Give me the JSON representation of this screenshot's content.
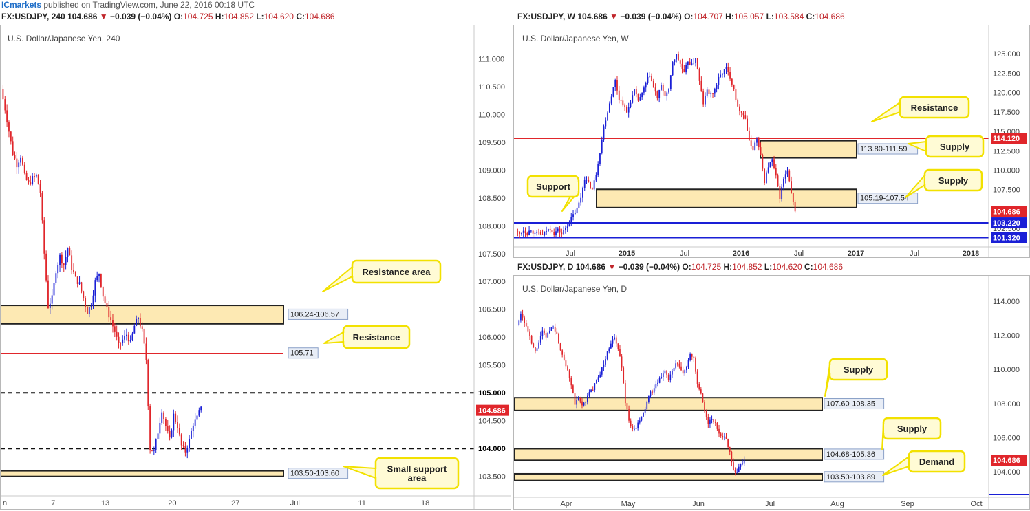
{
  "header": {
    "brand": "ICmarkets",
    "published": " published on TradingView.com, June 22, 2016 00:18 UTC"
  },
  "colors": {
    "up": "#1a1fd6",
    "down": "#e0262b",
    "zone_fill": "#fde9b3",
    "resistance_line": "#e0262b",
    "support_line": "#1a1fd6",
    "callout_fill": "#fffbd5",
    "callout_border": "#f2e100",
    "price_badge": "#e0262b"
  },
  "panels": {
    "h4": {
      "symbol": "FX:USDJPY, 240",
      "last": "104.686",
      "arrow": "▼",
      "change": "−0.039 (−0.04%)",
      "o": "104.725",
      "h": "104.852",
      "l": "104.620",
      "c": "104.686",
      "title": "U.S. Dollar/Japanese Yen, 240"
    },
    "weekly": {
      "symbol": "FX:USDJPY, W",
      "last": "104.686",
      "arrow": "▼",
      "change": "−0.039 (−0.04%)",
      "o": "104.707",
      "h": "105.057",
      "l": "103.584",
      "c": "104.686",
      "title": "U.S. Dollar/Japanese Yen, W"
    },
    "daily": {
      "symbol": "FX:USDJPY, D",
      "last": "104.686",
      "arrow": "▼",
      "change": "−0.039 (−0.04%)",
      "o": "104.725",
      "h": "104.852",
      "l": "104.620",
      "c": "104.686",
      "title": "U.S. Dollar/Japanese Yen, D"
    }
  },
  "chart_data": [
    {
      "id": "h4",
      "type": "candlestick",
      "ylim": [
        103.2,
        111.3
      ],
      "y_ticks": [
        "111.000",
        "110.500",
        "110.000",
        "109.500",
        "109.000",
        "108.500",
        "108.000",
        "107.500",
        "107.000",
        "106.500",
        "106.000",
        "105.500",
        "105.000",
        "104.500",
        "104.000",
        "103.500"
      ],
      "y_tick_values": [
        111.0,
        110.5,
        110.0,
        109.5,
        109.0,
        108.5,
        108.0,
        107.5,
        107.0,
        106.5,
        106.0,
        105.5,
        105.0,
        104.5,
        104.0,
        103.5
      ],
      "bold_ticks": [
        "105.000",
        "104.000"
      ],
      "x_ticks": [
        "n",
        "7",
        "13",
        "20",
        "27",
        "Jul",
        "11",
        "18"
      ],
      "x_tick_index": [
        0,
        13,
        27,
        45,
        62,
        78,
        96,
        113
      ],
      "x_count": 126,
      "current_price": 104.686,
      "price_series": [
        110.45,
        110.1,
        109.7,
        109.3,
        109.1,
        109.25,
        108.9,
        108.75,
        108.85,
        108.9,
        108.6,
        107.5,
        106.55,
        106.7,
        107.2,
        107.45,
        107.3,
        107.6,
        107.25,
        107.05,
        106.95,
        106.7,
        106.45,
        106.6,
        107.0,
        107.15,
        106.75,
        106.5,
        106.3,
        106.1,
        105.85,
        105.95,
        106.05,
        105.9,
        106.2,
        106.35,
        106.1,
        105.6,
        104.0,
        103.95,
        104.3,
        104.7,
        104.4,
        104.15,
        104.6,
        104.4,
        104.05,
        103.95,
        104.15,
        104.45,
        104.55,
        104.75
      ],
      "zones": [
        {
          "label": "106.24-106.57",
          "low": 106.24,
          "high": 106.57,
          "callout": "Resistance area"
        },
        {
          "label": "103.50-103.60",
          "low": 103.5,
          "high": 103.6,
          "callout": "Small support area"
        }
      ],
      "lines": [
        {
          "label": "105.71",
          "value": 105.71,
          "style": "solid",
          "callout": "Resistance"
        },
        {
          "value": 105.0,
          "style": "dashed"
        },
        {
          "value": 104.0,
          "style": "dashed"
        }
      ]
    },
    {
      "id": "weekly",
      "type": "candlestick",
      "ylim": [
        100.3,
        126.7
      ],
      "y_ticks": [
        "125.000",
        "122.500",
        "120.000",
        "117.500",
        "115.000",
        "112.500",
        "110.000",
        "107.500",
        "105.000",
        "102.500"
      ],
      "y_tick_values": [
        125.0,
        122.5,
        120.0,
        117.5,
        115.0,
        112.5,
        110.0,
        107.5,
        105.0,
        102.5
      ],
      "x_ticks": [
        "Jul",
        "2015",
        "Jul",
        "2016",
        "Jul",
        "2017",
        "Jul",
        "2018"
      ],
      "current_price": 104.686,
      "price_series": [
        102.1,
        101.8,
        102.3,
        101.9,
        102.4,
        101.7,
        102.0,
        101.6,
        102.2,
        102.5,
        101.9,
        102.3,
        101.8,
        102.6,
        103.3,
        104.2,
        105.0,
        106.5,
        109.0,
        108.3,
        107.5,
        109.6,
        112.4,
        115.6,
        117.6,
        119.7,
        121.5,
        119.2,
        118.6,
        117.4,
        118.9,
        120.2,
        119.0,
        119.8,
        121.2,
        122.3,
        120.6,
        119.4,
        120.8,
        119.7,
        120.2,
        124.0,
        124.8,
        123.7,
        122.4,
        124.1,
        123.5,
        124.5,
        121.4,
        118.6,
        120.3,
        119.7,
        120.4,
        121.8,
        122.6,
        123.1,
        122.0,
        120.5,
        118.0,
        117.6,
        116.7,
        113.6,
        112.8,
        114.1,
        111.7,
        108.6,
        110.5,
        111.3,
        109.1,
        106.5,
        108.9,
        109.9,
        106.9,
        104.7
      ],
      "zones": [
        {
          "label": "113.80-111.59",
          "low": 111.59,
          "high": 113.8,
          "callout": "Supply"
        },
        {
          "label": "105.19-107.54",
          "low": 105.19,
          "high": 107.54,
          "callout": "Supply"
        }
      ],
      "lines": [
        {
          "label": "114.120",
          "value": 114.12,
          "color": "red"
        },
        {
          "label": "103.220",
          "value": 103.22,
          "color": "blue"
        },
        {
          "label": "101.320",
          "value": 101.32,
          "color": "blue"
        }
      ],
      "callouts": [
        "Resistance",
        "Supply",
        "Supply",
        "Support"
      ]
    },
    {
      "id": "daily",
      "type": "candlestick",
      "ylim": [
        102.6,
        114.6
      ],
      "y_ticks": [
        "114.000",
        "112.000",
        "110.000",
        "108.000",
        "106.000",
        "104.000"
      ],
      "y_tick_values": [
        114.0,
        112.0,
        110.0,
        108.0,
        106.0,
        104.0
      ],
      "x_ticks": [
        "Apr",
        "May",
        "Jun",
        "Jul",
        "Aug",
        "Sep",
        "Oct"
      ],
      "current_price": 104.686,
      "price_series": [
        112.6,
        113.3,
        112.8,
        112.2,
        111.5,
        111.0,
        111.6,
        112.2,
        111.9,
        112.3,
        112.6,
        112.0,
        111.2,
        110.6,
        110.0,
        109.0,
        108.0,
        108.3,
        107.9,
        108.2,
        108.6,
        108.9,
        109.3,
        109.8,
        110.3,
        111.0,
        111.6,
        111.8,
        111.2,
        110.2,
        108.1,
        107.1,
        106.4,
        106.6,
        107.0,
        107.4,
        108.1,
        108.6,
        108.9,
        109.2,
        109.6,
        110.0,
        109.4,
        109.9,
        110.3,
        110.2,
        109.7,
        110.2,
        111.0,
        110.6,
        109.1,
        108.5,
        107.5,
        106.9,
        107.1,
        106.8,
        106.3,
        106.1,
        105.9,
        105.2,
        104.1,
        104.0,
        104.5,
        104.7
      ],
      "zones": [
        {
          "label": "107.60-108.35",
          "low": 107.6,
          "high": 108.35,
          "callout": "Supply"
        },
        {
          "label": "104.68-105.36",
          "low": 104.68,
          "high": 105.36,
          "callout": "Supply"
        },
        {
          "label": "103.50-103.89",
          "low": 103.5,
          "high": 103.89,
          "callout": "Demand"
        }
      ]
    }
  ]
}
